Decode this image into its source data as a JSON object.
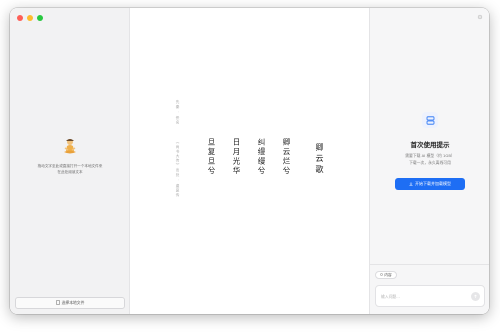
{
  "left": {
    "hint_line1": "拖动文字至此或直接打开一个本地文件来",
    "hint_line2": "在此处阅读文本",
    "open_file_label": "选择本地文件"
  },
  "poem": {
    "title": "卿云歌",
    "lines": [
      "卿云烂兮",
      "纠缦缦兮",
      "日月光华",
      "旦复旦兮"
    ],
    "meta_1": "先秦 · 佚名",
    "meta_2": "《尚书大传》",
    "meta_3": "出处 · 虞夏传"
  },
  "right": {
    "title": "首次使用提示",
    "desc_line1": "需要下载 AI 模型（约 1GB）",
    "desc_line2": "下载一次，永久离线可用",
    "download_label": "开始下载并加载模型",
    "content_chip": "内容",
    "chat_placeholder": "输入问题..."
  },
  "icons": {
    "settings": "gear-icon",
    "doc": "document-icon",
    "download": "download-icon",
    "send": "send-icon",
    "mascot": "meditating-figure-icon"
  },
  "colors": {
    "accent": "#1e6ef4",
    "red": "#fe5f57",
    "yellow": "#febc2e",
    "green": "#28c840"
  }
}
